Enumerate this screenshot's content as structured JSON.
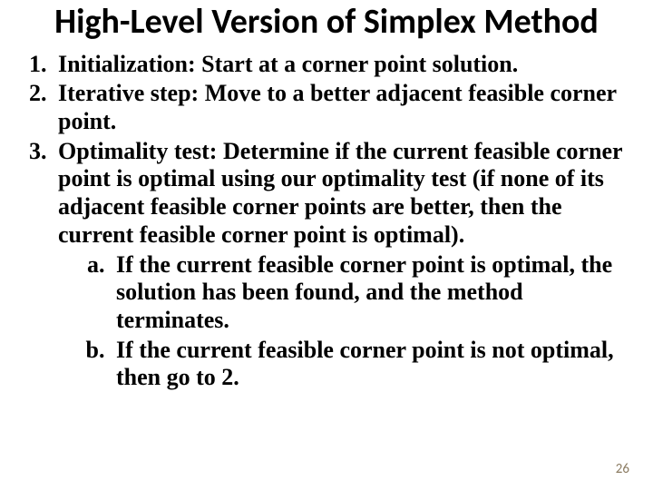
{
  "title": "High-Level Version of Simplex Method",
  "steps": {
    "s1": "Initialization: Start at a corner point solution.",
    "s2": "Iterative step: Move to a better adjacent feasible corner point.",
    "s3": "Optimality test: Determine if the current feasible corner point is optimal using our optimality test (if none of its adjacent feasible corner points are better, then the current feasible corner point is optimal).",
    "s3a": "If the current feasible corner point is optimal, the solution has been found, and the method terminates.",
    "s3b": "If the current feasible corner point is not optimal, then go to 2."
  },
  "page_number": "26"
}
